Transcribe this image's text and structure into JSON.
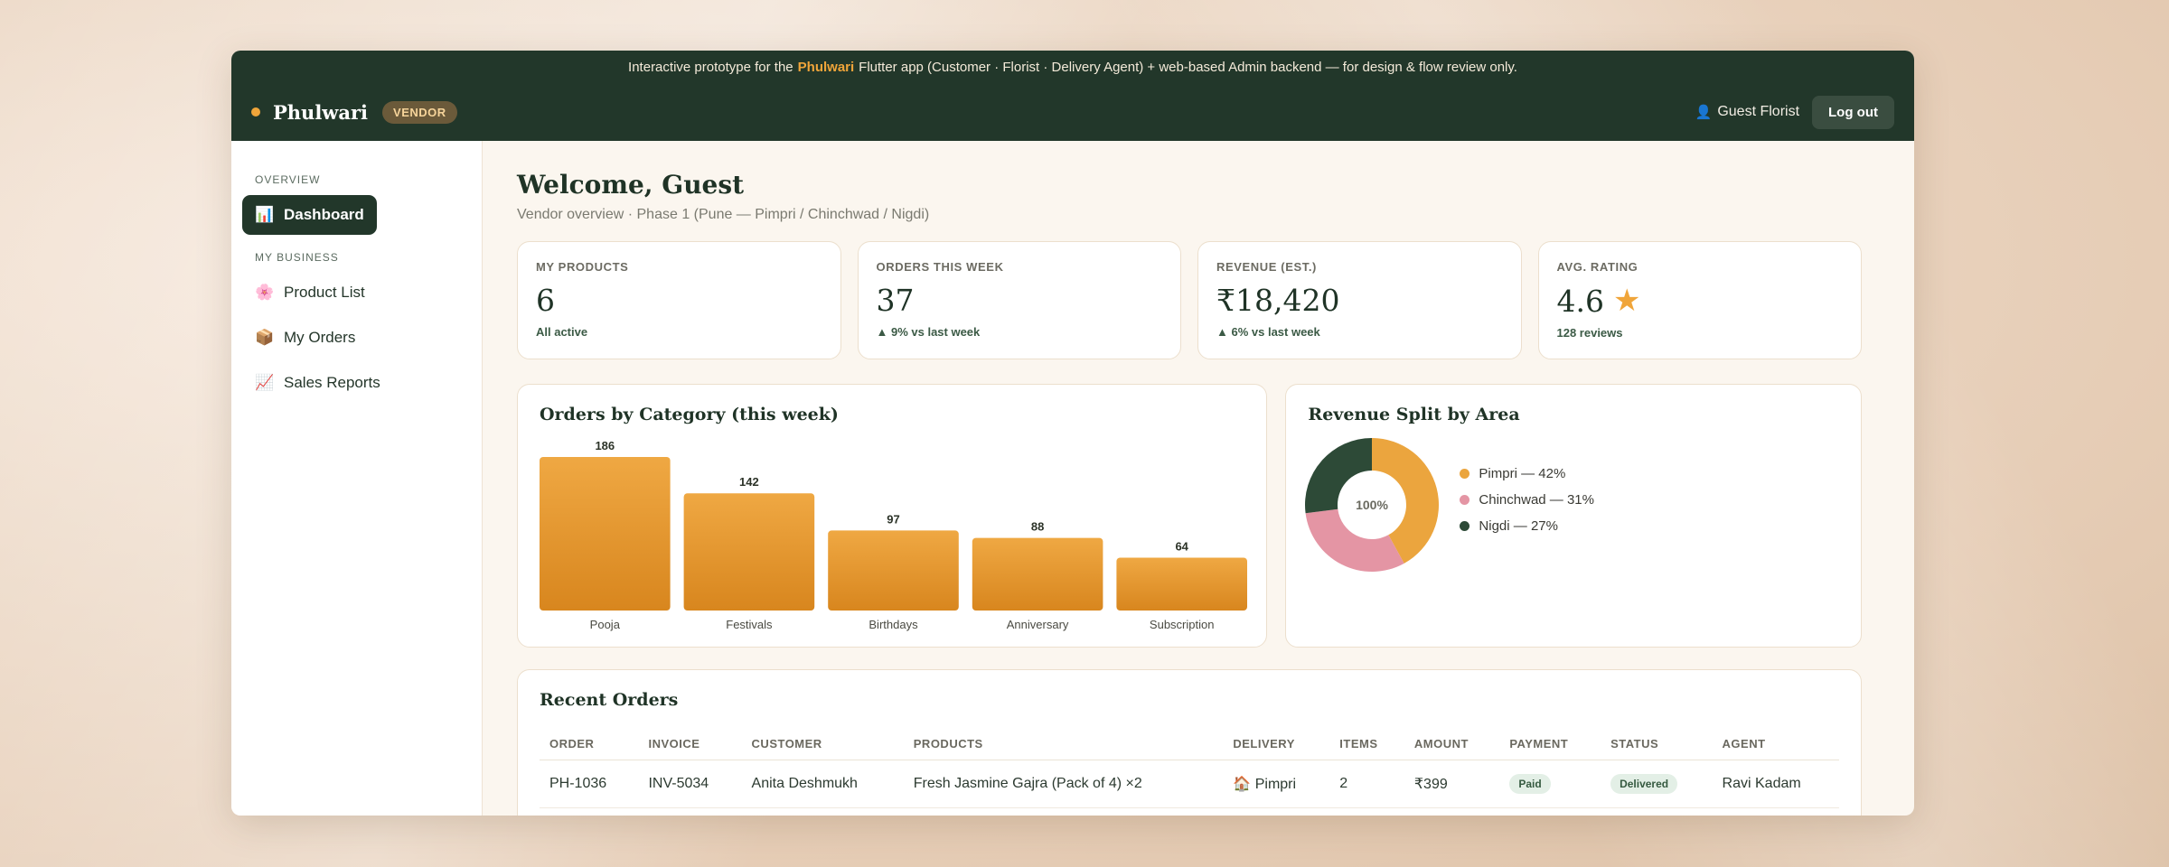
{
  "banner": {
    "prefix": "Interactive prototype for the",
    "brand": "Phulwari",
    "suffix": "Flutter app (Customer · Florist · Delivery Agent) + web-based Admin backend — for design & flow review only."
  },
  "header": {
    "logo": "Phulwari",
    "badge": "VENDOR",
    "user_icon": "👤",
    "user_name": "Guest Florist",
    "logout_label": "Log out"
  },
  "sidebar": {
    "section1": "OVERVIEW",
    "section2": "MY BUSINESS",
    "items": [
      {
        "label": "Dashboard",
        "icon": "📊",
        "active": true
      },
      {
        "label": "Product List",
        "icon": "🌸"
      },
      {
        "label": "My Orders",
        "icon": "📦"
      },
      {
        "label": "Sales Reports",
        "icon": "📈"
      }
    ]
  },
  "main": {
    "title": "Welcome, Guest",
    "subtitle": "Vendor overview · Phase 1 (Pune — Pimpri / Chinchwad / Nigdi)"
  },
  "stats": [
    {
      "label": "MY PRODUCTS",
      "value": "6",
      "note": "All active"
    },
    {
      "label": "ORDERS THIS WEEK",
      "value": "37",
      "note": "▲ 9% vs last week"
    },
    {
      "label": "REVENUE (EST.)",
      "value": "₹18,420",
      "note": "▲ 6% vs last week"
    },
    {
      "label": "AVG. RATING",
      "value": "4.6",
      "star": "★",
      "note": "128 reviews"
    }
  ],
  "bar_chart_title": "Orders by Category (this week)",
  "donut_title": "Revenue Split by Area",
  "donut_center": "100%",
  "chart_data": [
    {
      "type": "bar",
      "title": "Orders by Category (this week)",
      "categories": [
        "Pooja",
        "Festivals",
        "Birthdays",
        "Anniversary",
        "Subscription"
      ],
      "values": [
        186,
        142,
        97,
        88,
        64
      ],
      "color": "#e39a30"
    },
    {
      "type": "pie",
      "title": "Revenue Split by Area",
      "categories": [
        "Pimpri",
        "Chinchwad",
        "Nigdi"
      ],
      "values": [
        42,
        31,
        27
      ],
      "labels": [
        "Pimpri — 42%",
        "Chinchwad — 31%",
        "Nigdi — 27%"
      ],
      "colors": [
        "#eba53e",
        "#e495a4",
        "#2d4a37"
      ]
    }
  ],
  "orders": {
    "title": "Recent Orders",
    "columns": [
      "ORDER",
      "INVOICE",
      "CUSTOMER",
      "PRODUCTS",
      "DELIVERY",
      "ITEMS",
      "AMOUNT",
      "PAYMENT",
      "STATUS",
      "AGENT"
    ],
    "rows": [
      {
        "order": "PH-1036",
        "invoice": "INV-5034",
        "customer": "Anita Deshmukh",
        "products": "Fresh Jasmine Gajra (Pack of 4) ×2",
        "delivery_icon": "🏠",
        "delivery": "Pimpri",
        "items": "2",
        "amount": "₹399",
        "payment": "Paid",
        "status": "Delivered",
        "agent": "Ravi Kadam"
      }
    ]
  }
}
